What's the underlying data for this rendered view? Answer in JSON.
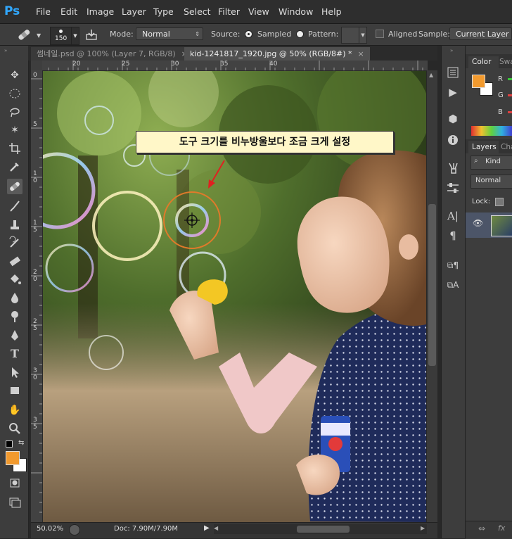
{
  "app": {
    "logo": "Ps",
    "accent": "#31a8ff"
  },
  "menu": [
    "File",
    "Edit",
    "Image",
    "Layer",
    "Type",
    "Select",
    "Filter",
    "View",
    "Window",
    "Help"
  ],
  "options": {
    "brush_size": "150",
    "mode_label": "Mode:",
    "mode_value": "Normal",
    "source_label": "Source:",
    "sampled_label": "Sampled",
    "pattern_label": "Pattern:",
    "aligned_label": "Aligned",
    "sample_label": "Sample:",
    "sample_value": "Current Layer"
  },
  "tabs": [
    {
      "label": "썸네일.psd @ 100% (Layer 7, RGB/8)",
      "close": "×"
    },
    {
      "label": "kid-1241817_1920.jpg @ 50% (RGB/8#) *",
      "close": "×"
    }
  ],
  "ruler": {
    "h": [
      "20",
      "25",
      "30",
      "35",
      "40"
    ],
    "v": [
      "0",
      "5",
      "1",
      "0",
      "1",
      "5",
      "2",
      "0",
      "2",
      "5",
      "3",
      "0",
      "3",
      "5"
    ]
  },
  "annotation": "도구 크기를 비누방울보다 조금 크게 설정",
  "status": {
    "zoom": "50.02%",
    "doc": "Doc: 7.90M/7.90M"
  },
  "panels": {
    "color_tab": "Color",
    "swatches_tab": "Swa",
    "rgb": [
      "R",
      "G",
      "B"
    ],
    "layers_tab": "Layers",
    "channels_tab": "Cha",
    "kind_label": "Kind",
    "blend_mode": "Normal",
    "lock_label": "Lock:",
    "footer_link": "⇔",
    "footer_fx": "fx"
  },
  "colors": {
    "foreground": "#f29a2e",
    "background": "#ffffff",
    "annotation_bg": "#fff7c8"
  }
}
